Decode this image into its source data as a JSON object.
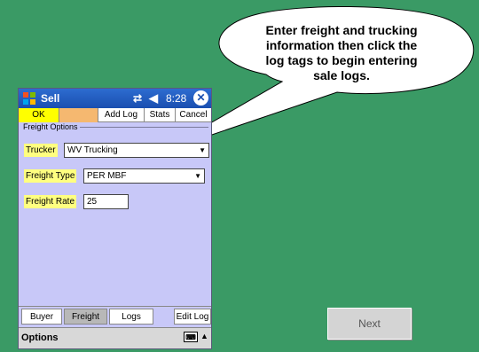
{
  "callout": {
    "lines": [
      "Enter freight and trucking",
      "information then click the",
      "log tags to begin entering",
      "sale logs."
    ]
  },
  "window": {
    "title": "Sell",
    "time": "8:28",
    "icons": [
      "windows-flag-icon",
      "sync-icon",
      "volume-icon",
      "close-icon"
    ]
  },
  "toolbar": {
    "ok": "OK",
    "add_log": "Add Log",
    "stats": "Stats",
    "cancel": "Cancel"
  },
  "freight": {
    "group_label": "Freight Options",
    "trucker_label": "Trucker",
    "trucker_value": "WV Trucking",
    "type_label": "Freight Type",
    "type_value": "PER MBF",
    "rate_label": "Freight Rate",
    "rate_value": "25"
  },
  "tabs": {
    "buyer": "Buyer",
    "freight": "Freight",
    "logs": "Logs",
    "edit_log": "Edit Log"
  },
  "menubar": {
    "options": "Options"
  },
  "next_button": "Next",
  "colors": {
    "background": "#3a9a65",
    "form_bg": "#c8c8f8",
    "label_bg": "#ffff80",
    "titlebar": "#1a4fb0"
  }
}
